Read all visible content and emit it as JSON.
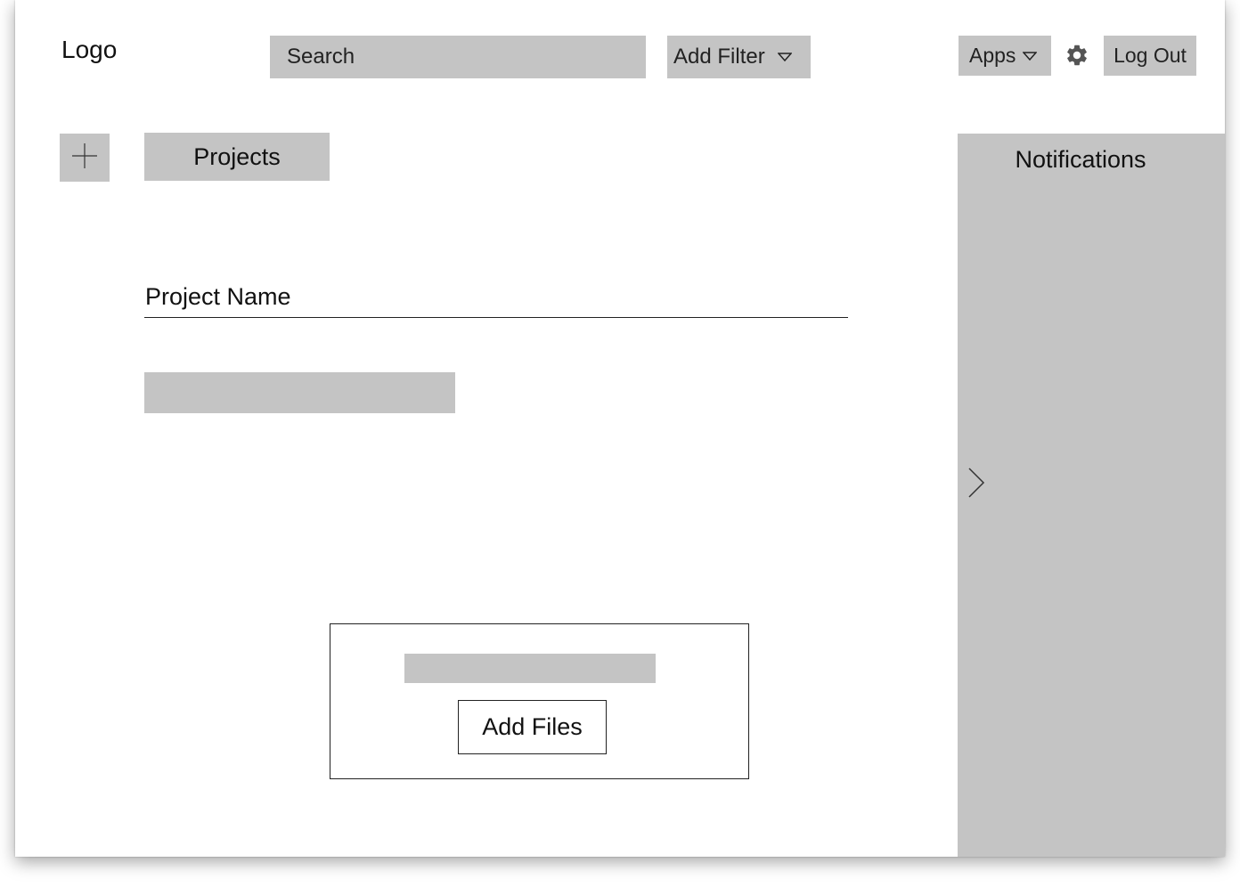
{
  "header": {
    "logo_text": "Logo",
    "search_placeholder": "Search",
    "filter_label": "Add Filter",
    "apps_label": "Apps",
    "settings_icon": "gear-icon",
    "logout_label": "Log Out"
  },
  "sidebar": {
    "add_icon": "plus-icon",
    "projects_label": "Projects"
  },
  "main": {
    "project_name_label": "Project Name",
    "upload": {
      "add_files_label": "Add Files"
    }
  },
  "notifications": {
    "title": "Notifications",
    "expand_icon": "chevron-right-icon"
  },
  "colors": {
    "placeholder_gray": "#c4c4c4",
    "text": "#111111",
    "background": "#ffffff"
  }
}
